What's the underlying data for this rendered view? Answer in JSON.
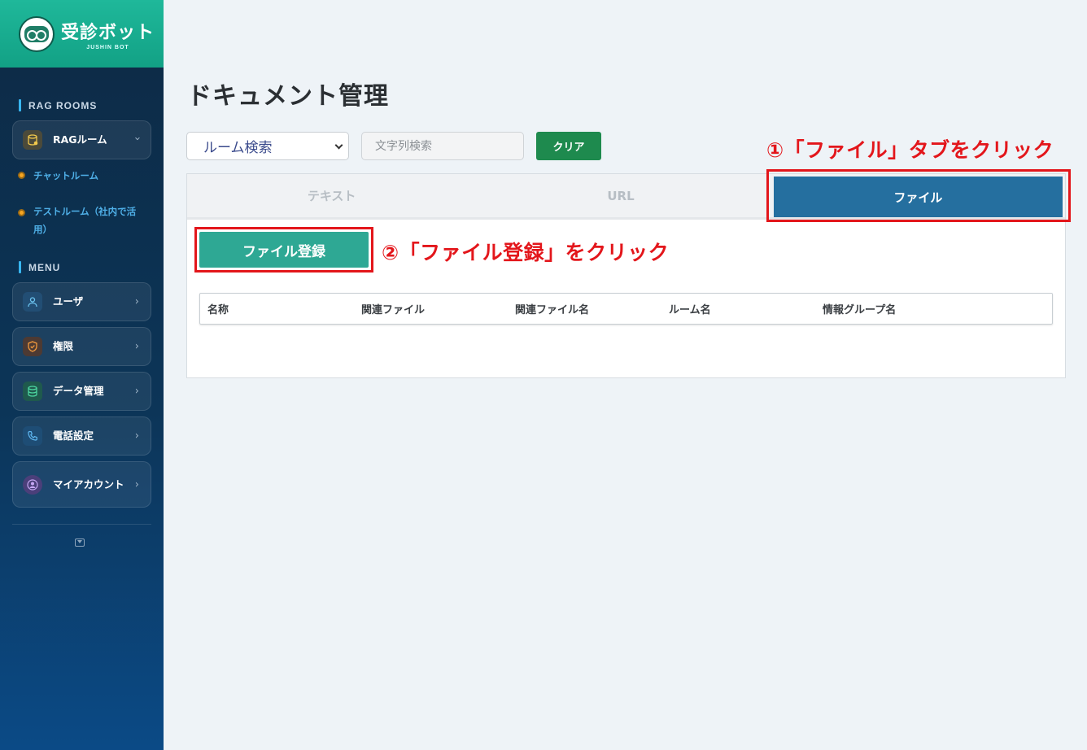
{
  "brand": {
    "name": "受診ボット",
    "sub": "JUSHIN BOT"
  },
  "sidebar": {
    "rag_section_title": "RAG ROOMS",
    "rag_item": {
      "label": "RAGルーム"
    },
    "rag_subitems": [
      {
        "label": "チャットルーム"
      },
      {
        "label": "テストルーム（社内で活用）"
      }
    ],
    "menu_section_title": "MENU",
    "menu_items": [
      {
        "label": "ユーザ",
        "icon": "user-icon"
      },
      {
        "label": "権限",
        "icon": "shield-icon"
      },
      {
        "label": "データ管理",
        "icon": "database-icon"
      },
      {
        "label": "電話設定",
        "icon": "phone-icon"
      },
      {
        "label": "マイアカウント",
        "icon": "account-icon"
      }
    ]
  },
  "main": {
    "title": "ドキュメント管理",
    "room_select": {
      "value": "ルーム検索"
    },
    "search": {
      "placeholder": "文字列検索"
    },
    "clear_label": "クリア",
    "tabs": [
      {
        "label": "テキスト",
        "active": false
      },
      {
        "label": "URL",
        "active": false
      },
      {
        "label": "ファイル",
        "active": true
      }
    ],
    "register_label": "ファイル登録",
    "table_headers": [
      "名称",
      "関連ファイル",
      "関連ファイル名",
      "ルーム名",
      "情報グループ名"
    ]
  },
  "annotations": {
    "step1": "①「ファイル」タブをクリック",
    "step2": "②「ファイル登録」をクリック"
  },
  "colors": {
    "accent_red": "#e3161b",
    "active_tab": "#256f9f",
    "register_button": "#2ea894",
    "clear_button": "#1e8a4e"
  }
}
